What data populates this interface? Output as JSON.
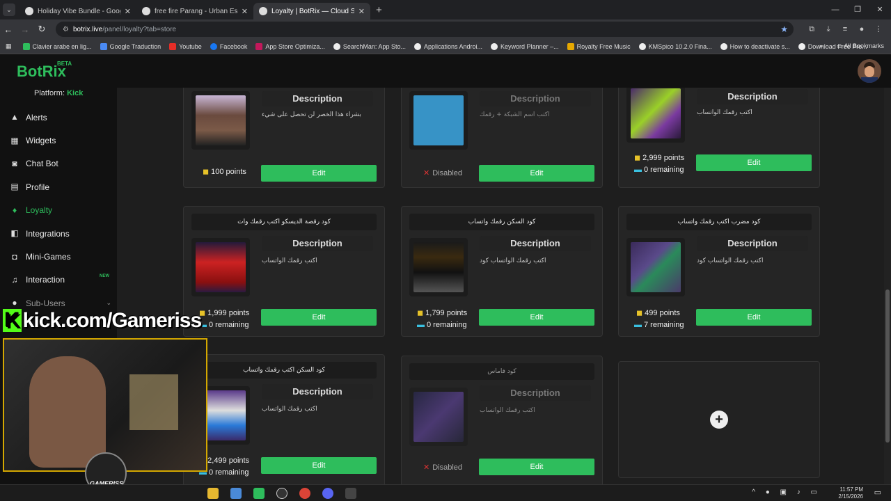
{
  "browser": {
    "tabs": [
      {
        "title": "Holiday Vibe Bundle - Google S",
        "active": false
      },
      {
        "title": "free fire Parang - Urban Escapa",
        "active": false
      },
      {
        "title": "Loyalty | BotRix — Cloud Strean",
        "active": true
      }
    ],
    "url_host": "botrix.live",
    "url_path": "/panel/loyalty?tab=store",
    "bookmarks": [
      "Clavier arabe en lig...",
      "Google Traduction",
      "Youtube",
      "Facebook",
      "App Store Optimiza...",
      "SearchMan: App Sto...",
      "Applications Androi...",
      "Keyword Planner –...",
      "Royalty Free Music",
      "KMSpico 10.2.0 Fina...",
      "How to deactivate s...",
      "Download Free Pre..."
    ],
    "all_bookmarks": "All Bookmarks"
  },
  "app": {
    "logo": "BotRix",
    "beta": "BETA",
    "platform_label": "Platform:",
    "platform_value": "Kick"
  },
  "sidebar": {
    "items": [
      {
        "label": "Alerts",
        "icon": "warning-icon"
      },
      {
        "label": "Widgets",
        "icon": "widgets-icon"
      },
      {
        "label": "Chat Bot",
        "icon": "robot-icon"
      },
      {
        "label": "Profile",
        "icon": "profile-icon"
      },
      {
        "label": "Loyalty",
        "icon": "gem-icon",
        "active": true
      },
      {
        "label": "Integrations",
        "icon": "integrations-icon"
      },
      {
        "label": "Mini-Games",
        "icon": "gamepad-icon"
      },
      {
        "label": "Interaction",
        "icon": "music-icon",
        "badge": "NEW"
      },
      {
        "label": "Sub-Users",
        "icon": "users-icon"
      }
    ]
  },
  "store": {
    "description_label": "Description",
    "edit_label": "Edit",
    "disabled_label": "Disabled",
    "cards": [
      {
        "title": "",
        "desc": "بشراء هذا الخصر لن تحصل على شيء",
        "points": "100 points",
        "remaining": "",
        "disabled": false
      },
      {
        "title": "",
        "desc": "اكتب اسم الشبكة + رقمك",
        "points": "",
        "remaining": "",
        "disabled": true
      },
      {
        "title": "",
        "desc": "اكتب رقمك الواتساب",
        "points": "2,999 points",
        "remaining": "0 remaining",
        "disabled": false
      },
      {
        "title": "كود رقصة الديسكو اكتب رقمك وات",
        "desc": "اكتب رقمك الواتساب",
        "points": "1,999 points",
        "remaining": "0 remaining",
        "disabled": false
      },
      {
        "title": "كود السكن رقمك واتساب",
        "desc": "اكتب رقمك الواتساب كود",
        "points": "1,799 points",
        "remaining": "0 remaining",
        "disabled": false
      },
      {
        "title": "كود مضرب اكتب رقمك واتساب",
        "desc": "اكتب رقمك الواتساب كود",
        "points": "499 points",
        "remaining": "7 remaining",
        "disabled": false
      },
      {
        "title": "كود السكن اكتب رقمك واتساب",
        "desc": "اكتب رقمك الواتساب",
        "points": "2,499 points",
        "remaining": "0 remaining",
        "disabled": false
      },
      {
        "title": "كود فاماس",
        "desc": "اكتب رقمك الواتساب",
        "points": "",
        "remaining": "",
        "disabled": true
      }
    ]
  },
  "overlay": {
    "kick_logo": "K",
    "kick_text": "kick.com/Gameriss",
    "badge": "GAMERISS"
  },
  "taskbar": {
    "time": "11:57 PM",
    "date": "2/15/2026"
  }
}
